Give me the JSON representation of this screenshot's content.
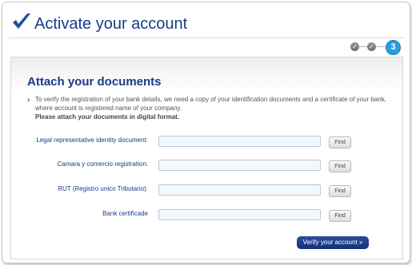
{
  "header": {
    "title": "Activate your account"
  },
  "steps": {
    "current": "3",
    "done_icon": "check-icon"
  },
  "section": {
    "title": "Attach your documents",
    "intro": "To verify the registration of your bank details, we need a copy of your identification documents and a certificate of your bank, where account is registered name of your company.",
    "intro_strong": "Please attach your documents in digital format."
  },
  "fields": [
    {
      "label": "Legal representative identity document:",
      "value": "",
      "button": "Find"
    },
    {
      "label": "Camara y comercio registration:",
      "value": "",
      "button": "Find"
    },
    {
      "label": "RUT (Registro unico Tributario):",
      "value": "",
      "button": "Find"
    },
    {
      "label": "Bank certificade",
      "value": "",
      "button": "Find"
    }
  ],
  "actions": {
    "verify_label": "Verify your account »"
  },
  "colors": {
    "brand": "#1a3a8a",
    "accent": "#26a0e0"
  }
}
